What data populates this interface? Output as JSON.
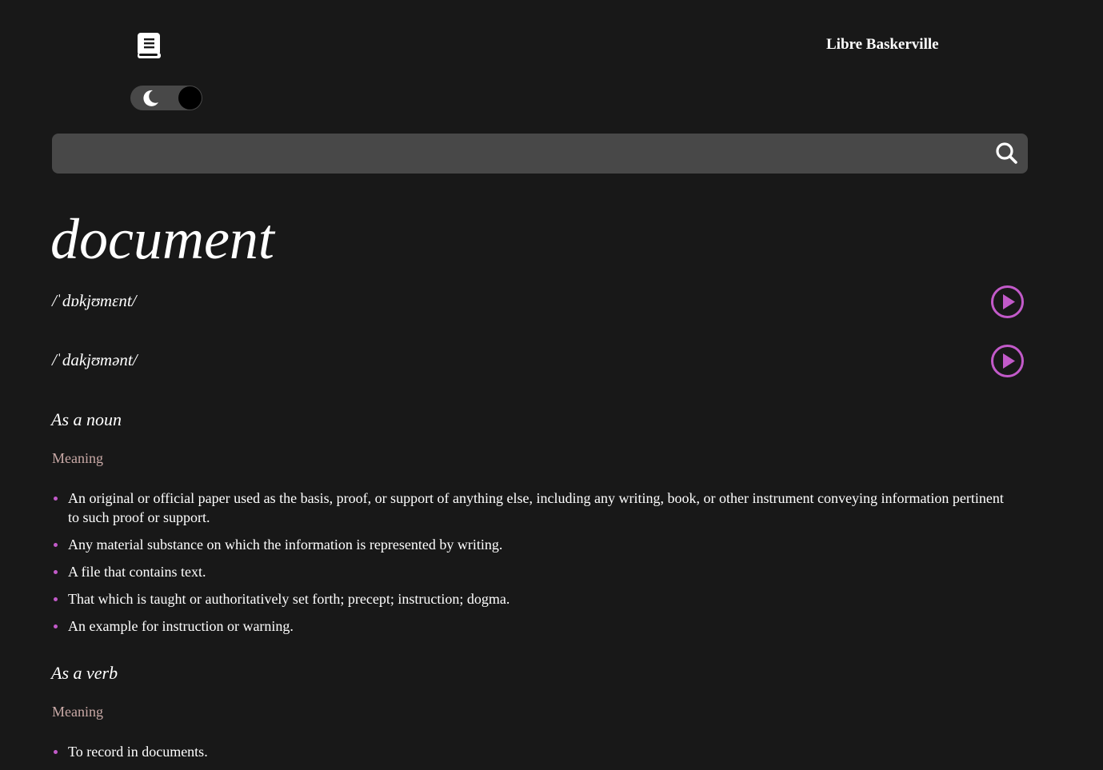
{
  "header": {
    "logo_icon": "book-icon",
    "font_name": "Libre Baskerville",
    "theme_toggle_icon": "moon-icon"
  },
  "search": {
    "value": "",
    "placeholder": "",
    "icon": "search-icon"
  },
  "entry": {
    "word": "document",
    "phonetics": [
      {
        "text": "/ˈdɒkjʊmɛnt/",
        "icon": "play-icon"
      },
      {
        "text": "/ˈdakjʊmənt/",
        "icon": "play-icon"
      }
    ],
    "meanings": [
      {
        "heading": "As a noun",
        "label": "Meaning",
        "definitions": [
          "An original or official paper used as the basis, proof, or support of anything else, including any writing, book, or other instrument conveying information pertinent to such proof or support.",
          "Any material substance on which the information is represented by writing.",
          "A file that contains text.",
          "That which is taught or authoritatively set forth; precept; instruction; dogma.",
          "An example for instruction or warning."
        ]
      },
      {
        "heading": "As a verb",
        "label": "Meaning",
        "definitions": [
          "To record in documents."
        ]
      }
    ]
  },
  "colors": {
    "background": "#181818",
    "surface": "#484848",
    "accent": "#c25ac9",
    "muted_label": "#c9a9a6"
  }
}
